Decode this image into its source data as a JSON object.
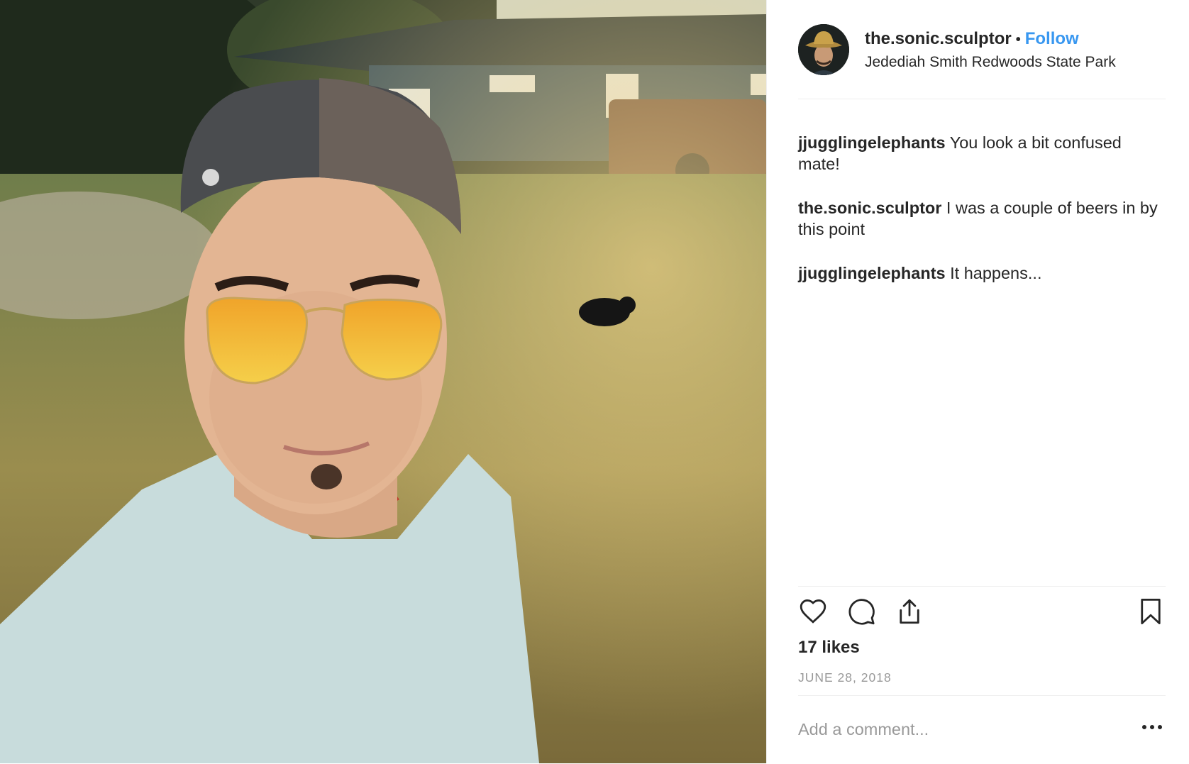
{
  "post": {
    "username": "the.sonic.sculptor",
    "separator": "•",
    "follow_label": "Follow",
    "location": "Jedediah Smith Redwoods State Park",
    "likes": "17 likes",
    "date": "JUNE 28, 2018"
  },
  "comments": [
    {
      "user": "jjugglingelephants",
      "text": "You look a bit confused mate!"
    },
    {
      "user": "the.sonic.sculptor",
      "text": "I was a couple of beers in by this point"
    },
    {
      "user": "jjugglingelephants",
      "text": "It happens..."
    }
  ],
  "comment_input": {
    "placeholder": "Add a comment..."
  },
  "icons": {
    "like": "heart-icon",
    "comment": "comment-bubble-icon",
    "share": "share-icon",
    "save": "bookmark-icon",
    "more": "more-options-icon"
  },
  "colors": {
    "accent": "#3897f0",
    "text": "#262626",
    "muted": "#999999",
    "divider": "#efefef"
  }
}
